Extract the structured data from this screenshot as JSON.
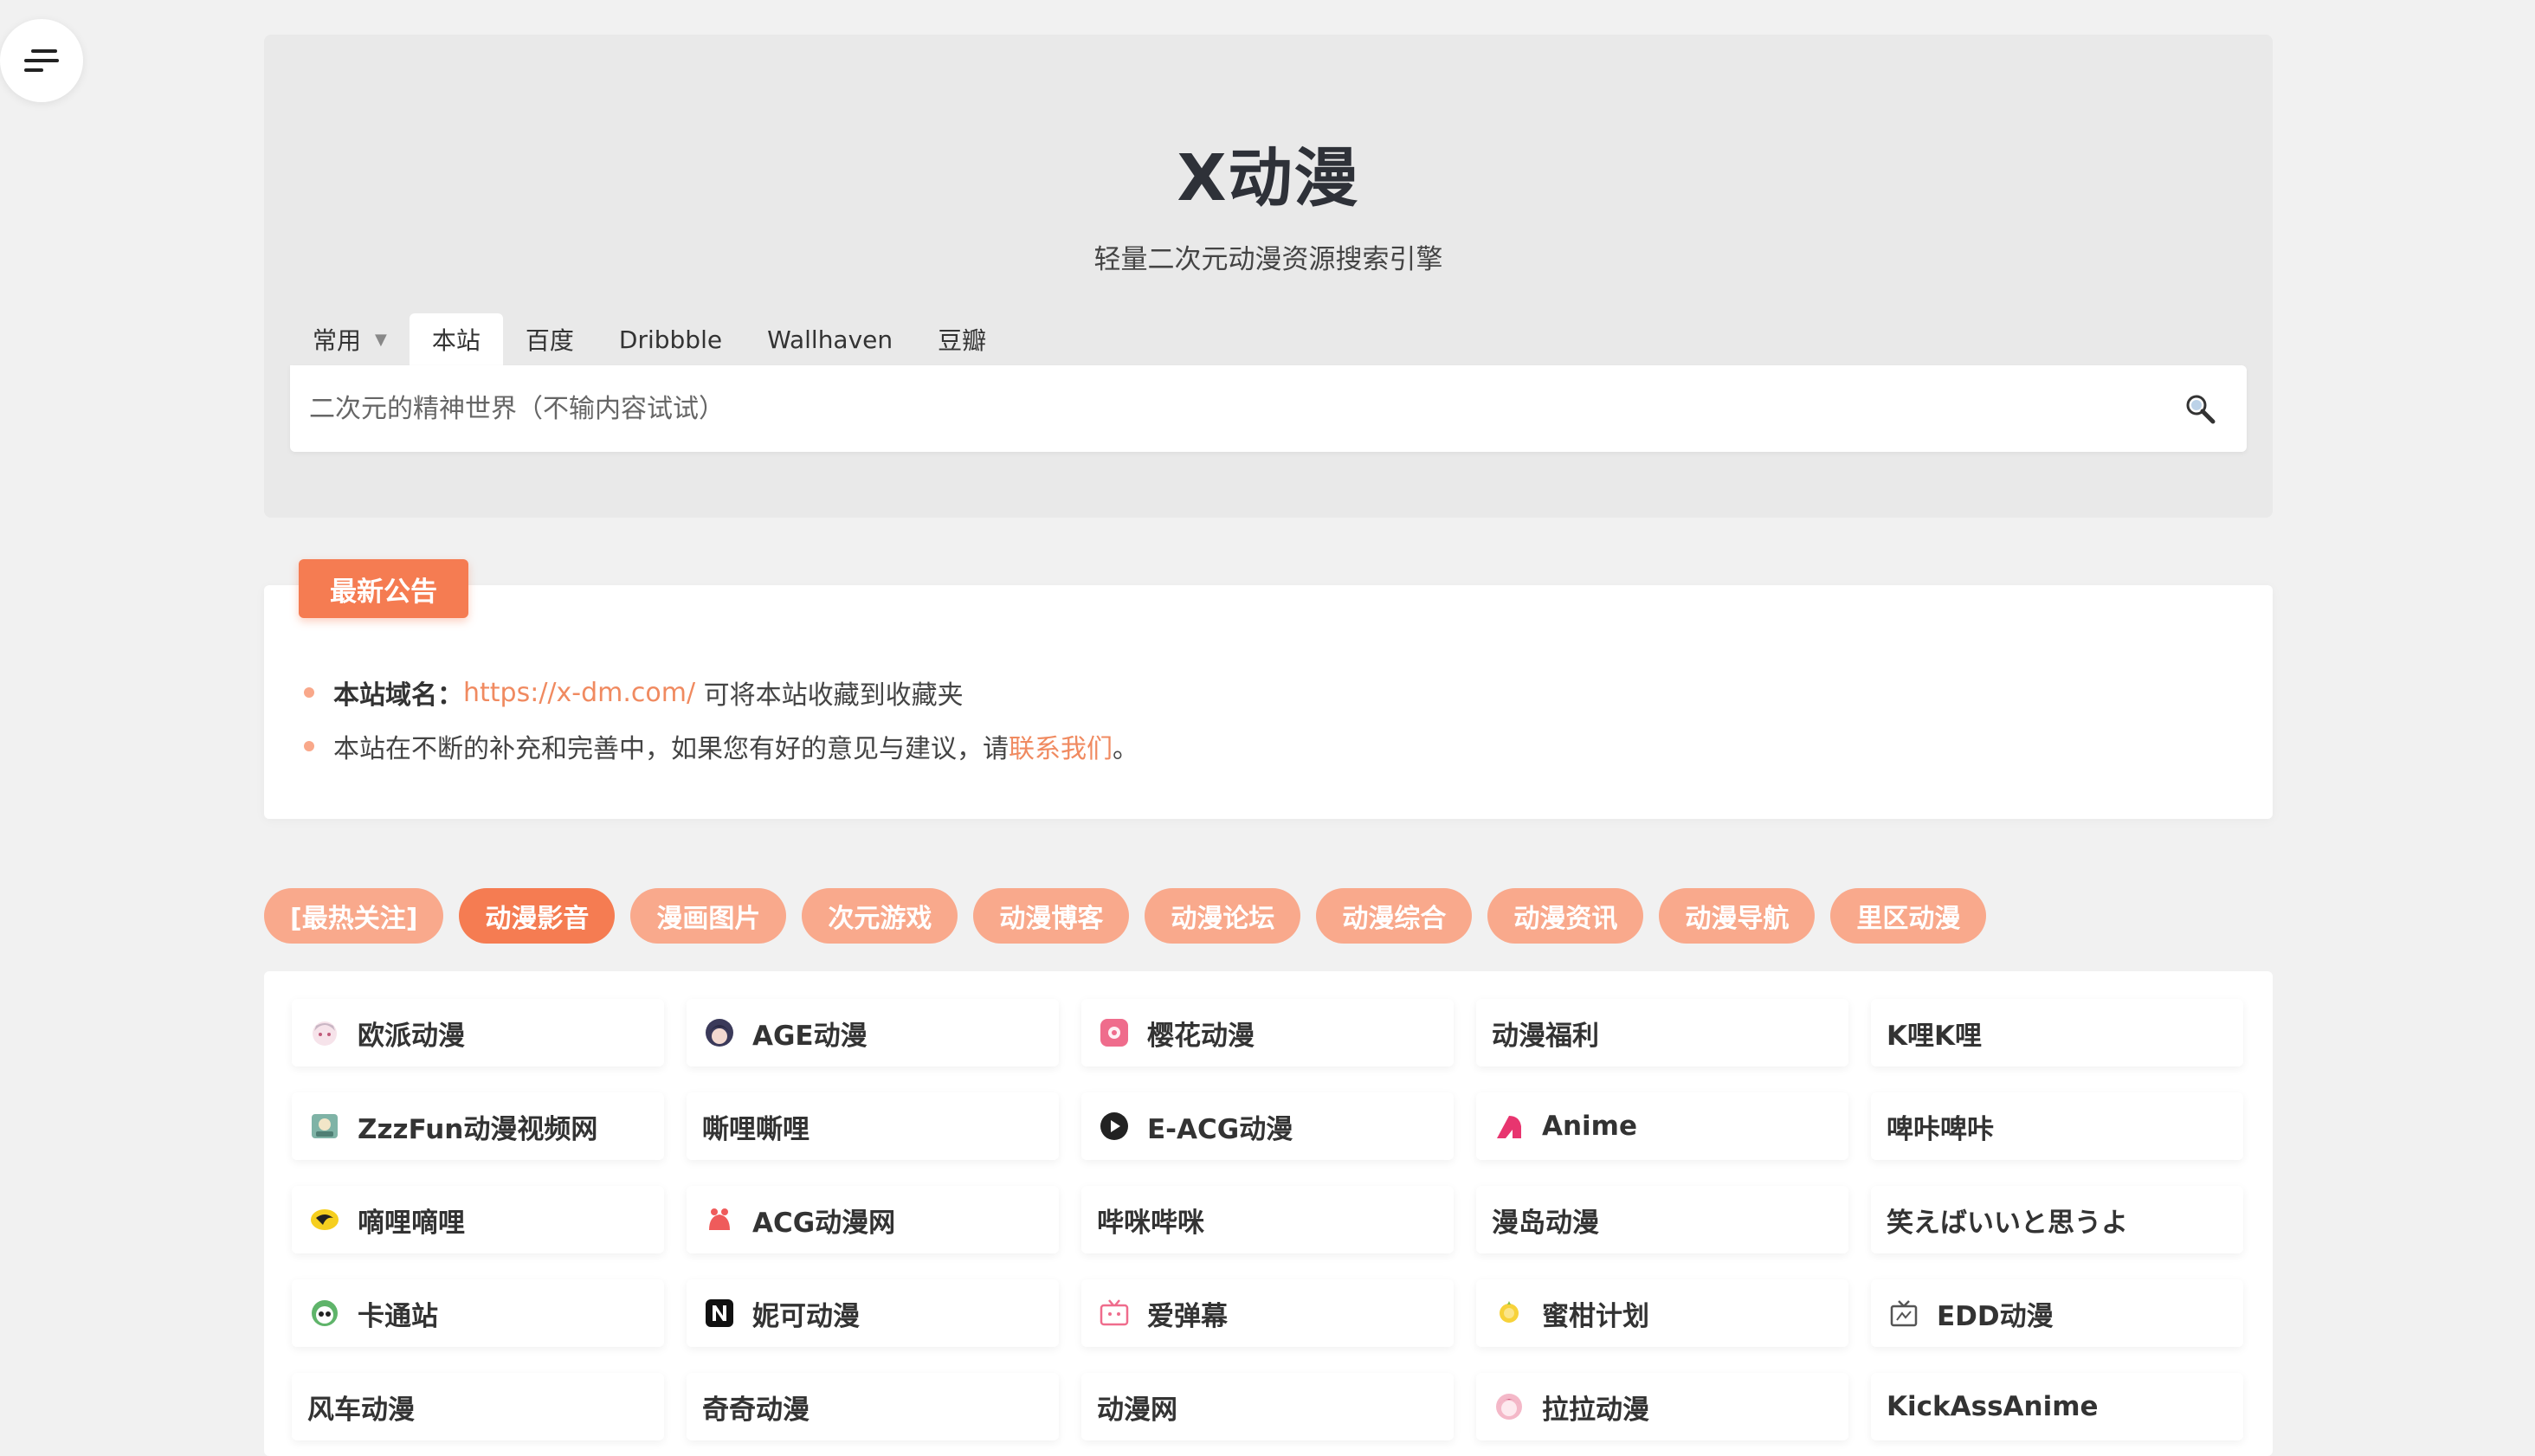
{
  "menu": {
    "icon": "menu-icon"
  },
  "header": {
    "title": "X动漫",
    "subtitle": "轻量二次元动漫资源搜索引擎"
  },
  "search": {
    "tabs": [
      {
        "label": "常用",
        "dropdown": true
      },
      {
        "label": "本站",
        "active": true
      },
      {
        "label": "百度"
      },
      {
        "label": "Dribbble"
      },
      {
        "label": "Wallhaven"
      },
      {
        "label": "豆瓣"
      }
    ],
    "placeholder": "二次元的精神世界（不输内容试试）",
    "icon": "search-icon"
  },
  "notice": {
    "badge": "最新公告",
    "line1": {
      "label": "本站域名：",
      "url": "https://x-dm.com/",
      "text": " 可将本站收藏到收藏夹"
    },
    "line2": {
      "text": "本站在不断的补充和完善中，如果您有好的意见与建议，请",
      "link": "联系我们",
      "end": "。"
    }
  },
  "categories": [
    {
      "label": "[最热关注]"
    },
    {
      "label": "动漫影音",
      "active": true
    },
    {
      "label": "漫画图片"
    },
    {
      "label": "次元游戏"
    },
    {
      "label": "动漫博客"
    },
    {
      "label": "动漫论坛"
    },
    {
      "label": "动漫综合"
    },
    {
      "label": "动漫资讯"
    },
    {
      "label": "动漫导航"
    },
    {
      "label": "里区动漫"
    }
  ],
  "sites": [
    {
      "name": "欧派动漫",
      "icon": "anime-girl-icon"
    },
    {
      "name": "AGE动漫",
      "icon": "anime-avatar-icon"
    },
    {
      "name": "樱花动漫",
      "icon": "sakura-icon"
    },
    {
      "name": "动漫福利",
      "icon": ""
    },
    {
      "name": "K哩K哩",
      "icon": ""
    },
    {
      "name": "ZzzFun动漫视频网",
      "icon": "zzzfun-icon"
    },
    {
      "name": "嘶哩嘶哩",
      "icon": ""
    },
    {
      "name": "E-ACG动漫",
      "icon": "play-circle-icon"
    },
    {
      "name": "Anime",
      "icon": "anime-logo-icon"
    },
    {
      "name": "啤咔啤咔",
      "icon": ""
    },
    {
      "name": "嘀哩嘀哩",
      "icon": "dilidili-icon"
    },
    {
      "name": "ACG动漫网",
      "icon": "acg-creature-icon"
    },
    {
      "name": "哔咪哔咪",
      "icon": ""
    },
    {
      "name": "漫岛动漫",
      "icon": ""
    },
    {
      "name": "笑えばいいと思うよ",
      "icon": ""
    },
    {
      "name": "卡通站",
      "icon": "panda-icon"
    },
    {
      "name": "妮可动漫",
      "icon": "n-logo-icon"
    },
    {
      "name": "爱弹幕",
      "icon": "tv-icon"
    },
    {
      "name": "蜜柑计划",
      "icon": "citrus-icon"
    },
    {
      "name": "EDD动漫",
      "icon": "retro-tv-icon"
    },
    {
      "name": "风车动漫",
      "icon": ""
    },
    {
      "name": "奇奇动漫",
      "icon": ""
    },
    {
      "name": "动漫网",
      "icon": ""
    },
    {
      "name": "拉拉动漫",
      "icon": "lala-icon"
    },
    {
      "name": "KickAssAnime",
      "icon": ""
    }
  ],
  "colors": {
    "accent": "#f57c52",
    "accent_light": "#f9a98c",
    "link": "#f08a60",
    "hero_bg": "#e9e9e9",
    "page_bg": "#f1f1f1"
  }
}
